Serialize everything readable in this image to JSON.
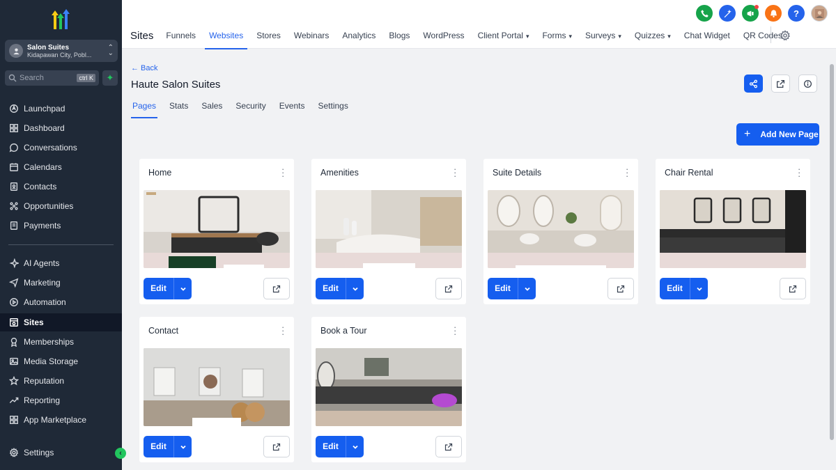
{
  "account": {
    "name": "Salon Suites",
    "location": "Kidapawan City, Pobl..."
  },
  "search": {
    "placeholder": "Search",
    "shortcut": "ctrl K"
  },
  "sidebar": {
    "items": [
      {
        "label": "Launchpad",
        "icon": "rocket-icon"
      },
      {
        "label": "Dashboard",
        "icon": "grid-icon"
      },
      {
        "label": "Conversations",
        "icon": "chat-icon"
      },
      {
        "label": "Calendars",
        "icon": "calendar-icon"
      },
      {
        "label": "Contacts",
        "icon": "contacts-icon"
      },
      {
        "label": "Opportunities",
        "icon": "opportunities-icon"
      },
      {
        "label": "Payments",
        "icon": "payments-icon"
      },
      {
        "label": "AI Agents",
        "icon": "sparkles-icon"
      },
      {
        "label": "Marketing",
        "icon": "send-icon"
      },
      {
        "label": "Automation",
        "icon": "automation-icon"
      },
      {
        "label": "Sites",
        "icon": "sites-icon",
        "active": true
      },
      {
        "label": "Memberships",
        "icon": "memberships-icon"
      },
      {
        "label": "Media Storage",
        "icon": "image-icon"
      },
      {
        "label": "Reputation",
        "icon": "star-icon"
      },
      {
        "label": "Reporting",
        "icon": "trend-icon"
      },
      {
        "label": "App Marketplace",
        "icon": "apps-icon"
      }
    ],
    "settings": "Settings"
  },
  "topnav": {
    "brand": "Sites",
    "tabs": [
      {
        "label": "Funnels"
      },
      {
        "label": "Websites",
        "active": true
      },
      {
        "label": "Stores"
      },
      {
        "label": "Webinars"
      },
      {
        "label": "Analytics"
      },
      {
        "label": "Blogs"
      },
      {
        "label": "WordPress"
      },
      {
        "label": "Client Portal",
        "dropdown": true
      },
      {
        "label": "Forms",
        "dropdown": true
      },
      {
        "label": "Surveys",
        "dropdown": true
      },
      {
        "label": "Quizzes",
        "dropdown": true
      },
      {
        "label": "Chat Widget"
      },
      {
        "label": "QR Codes"
      }
    ]
  },
  "header": {
    "back": "← Back",
    "title": "Haute Salon Suites",
    "subtabs": [
      {
        "label": "Pages",
        "active": true
      },
      {
        "label": "Stats"
      },
      {
        "label": "Sales"
      },
      {
        "label": "Security"
      },
      {
        "label": "Events"
      },
      {
        "label": "Settings"
      }
    ],
    "add_page": "Add New Page"
  },
  "pages": [
    {
      "title": "Home",
      "edit": "Edit"
    },
    {
      "title": "Amenities",
      "edit": "Edit"
    },
    {
      "title": "Suite Details",
      "edit": "Edit"
    },
    {
      "title": "Chair Rental",
      "edit": "Edit"
    },
    {
      "title": "Contact",
      "edit": "Edit"
    },
    {
      "title": "Book a Tour",
      "edit": "Edit"
    }
  ],
  "colors": {
    "primary": "#155eef",
    "sidebar": "#1f2937",
    "accent_green": "#22c55e"
  }
}
